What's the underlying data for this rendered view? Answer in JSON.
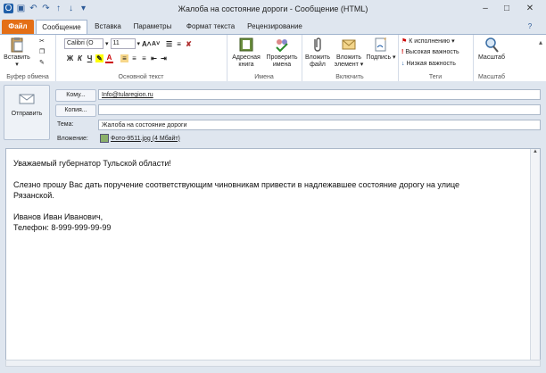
{
  "window": {
    "title": "Жалоба на состояние дороги - Сообщение (HTML)"
  },
  "tabs": [
    {
      "label": "Файл"
    },
    {
      "label": "Сообщение"
    },
    {
      "label": "Вставка"
    },
    {
      "label": "Параметры"
    },
    {
      "label": "Формат текста"
    },
    {
      "label": "Рецензирование"
    }
  ],
  "ribbon": {
    "clipboard": {
      "paste": "Вставить",
      "label": "Буфер обмена"
    },
    "font": {
      "family": "Calibri (O",
      "size": "11",
      "label": "Основной текст"
    },
    "names": {
      "address_book": "Адресная книга",
      "check_names": "Проверить имена",
      "label": "Имена"
    },
    "include": {
      "attach_file": "Вложить файл",
      "attach_item": "Вложить элемент",
      "signature": "Подпись",
      "label": "Включить"
    },
    "tags": {
      "follow_up": "К исполнению",
      "high": "Высокая важность",
      "low": "Низкая важность",
      "label": "Теги"
    },
    "zoom": {
      "zoom": "Масштаб",
      "label": "Масштаб"
    }
  },
  "header": {
    "send": "Отправить",
    "to_button": "Кому...",
    "to_value": "Info@tularegion.ru",
    "cc_button": "Копия...",
    "cc_value": "",
    "subject_label": "Тема:",
    "subject_value": "Жалоба на состояние дороги",
    "attach_label": "Вложение:",
    "attach_value": "Фото-9511.jpg (4 Мбайт)"
  },
  "body": {
    "greeting": "Уважаемый губернатор Тульской области!",
    "line1": "Слезно прошу Вас дать поручение соответствующим чиновникам привести в надлежавшее состояние дорогу на улице",
    "line2": "Рязанской.",
    "sign_name": "Иванов Иван Иванович,",
    "sign_phone": "Телефон: 8-999-999-99-99"
  },
  "colors": {
    "accent": "#e46f16",
    "chrome": "#dfe6ef"
  }
}
